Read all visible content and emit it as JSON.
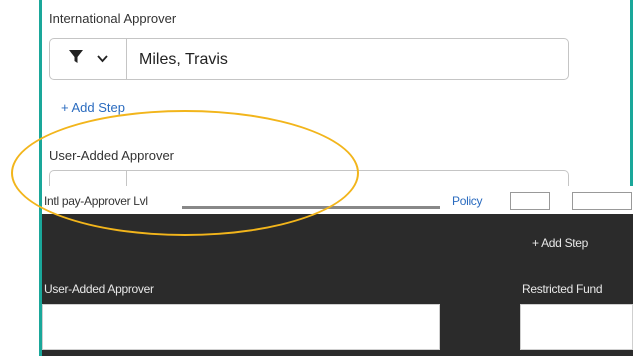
{
  "international": {
    "label": "International Approver",
    "value": "Miles, Travis"
  },
  "add_step_1": "+ Add Step",
  "user_added": {
    "label": "User-Added Approver"
  },
  "overlay": {
    "row_text": "Intl pay-Approver Lvl",
    "link_text": "Policy",
    "add_step": "+ Add Step",
    "left_label": "User-Added Approver",
    "right_label": "Restricted Fund"
  },
  "colors": {
    "border_teal": "#1aa79a",
    "highlight": "#f2b51b",
    "link_blue": "#2a6bbf",
    "dark_bg": "#2b2b2b"
  }
}
